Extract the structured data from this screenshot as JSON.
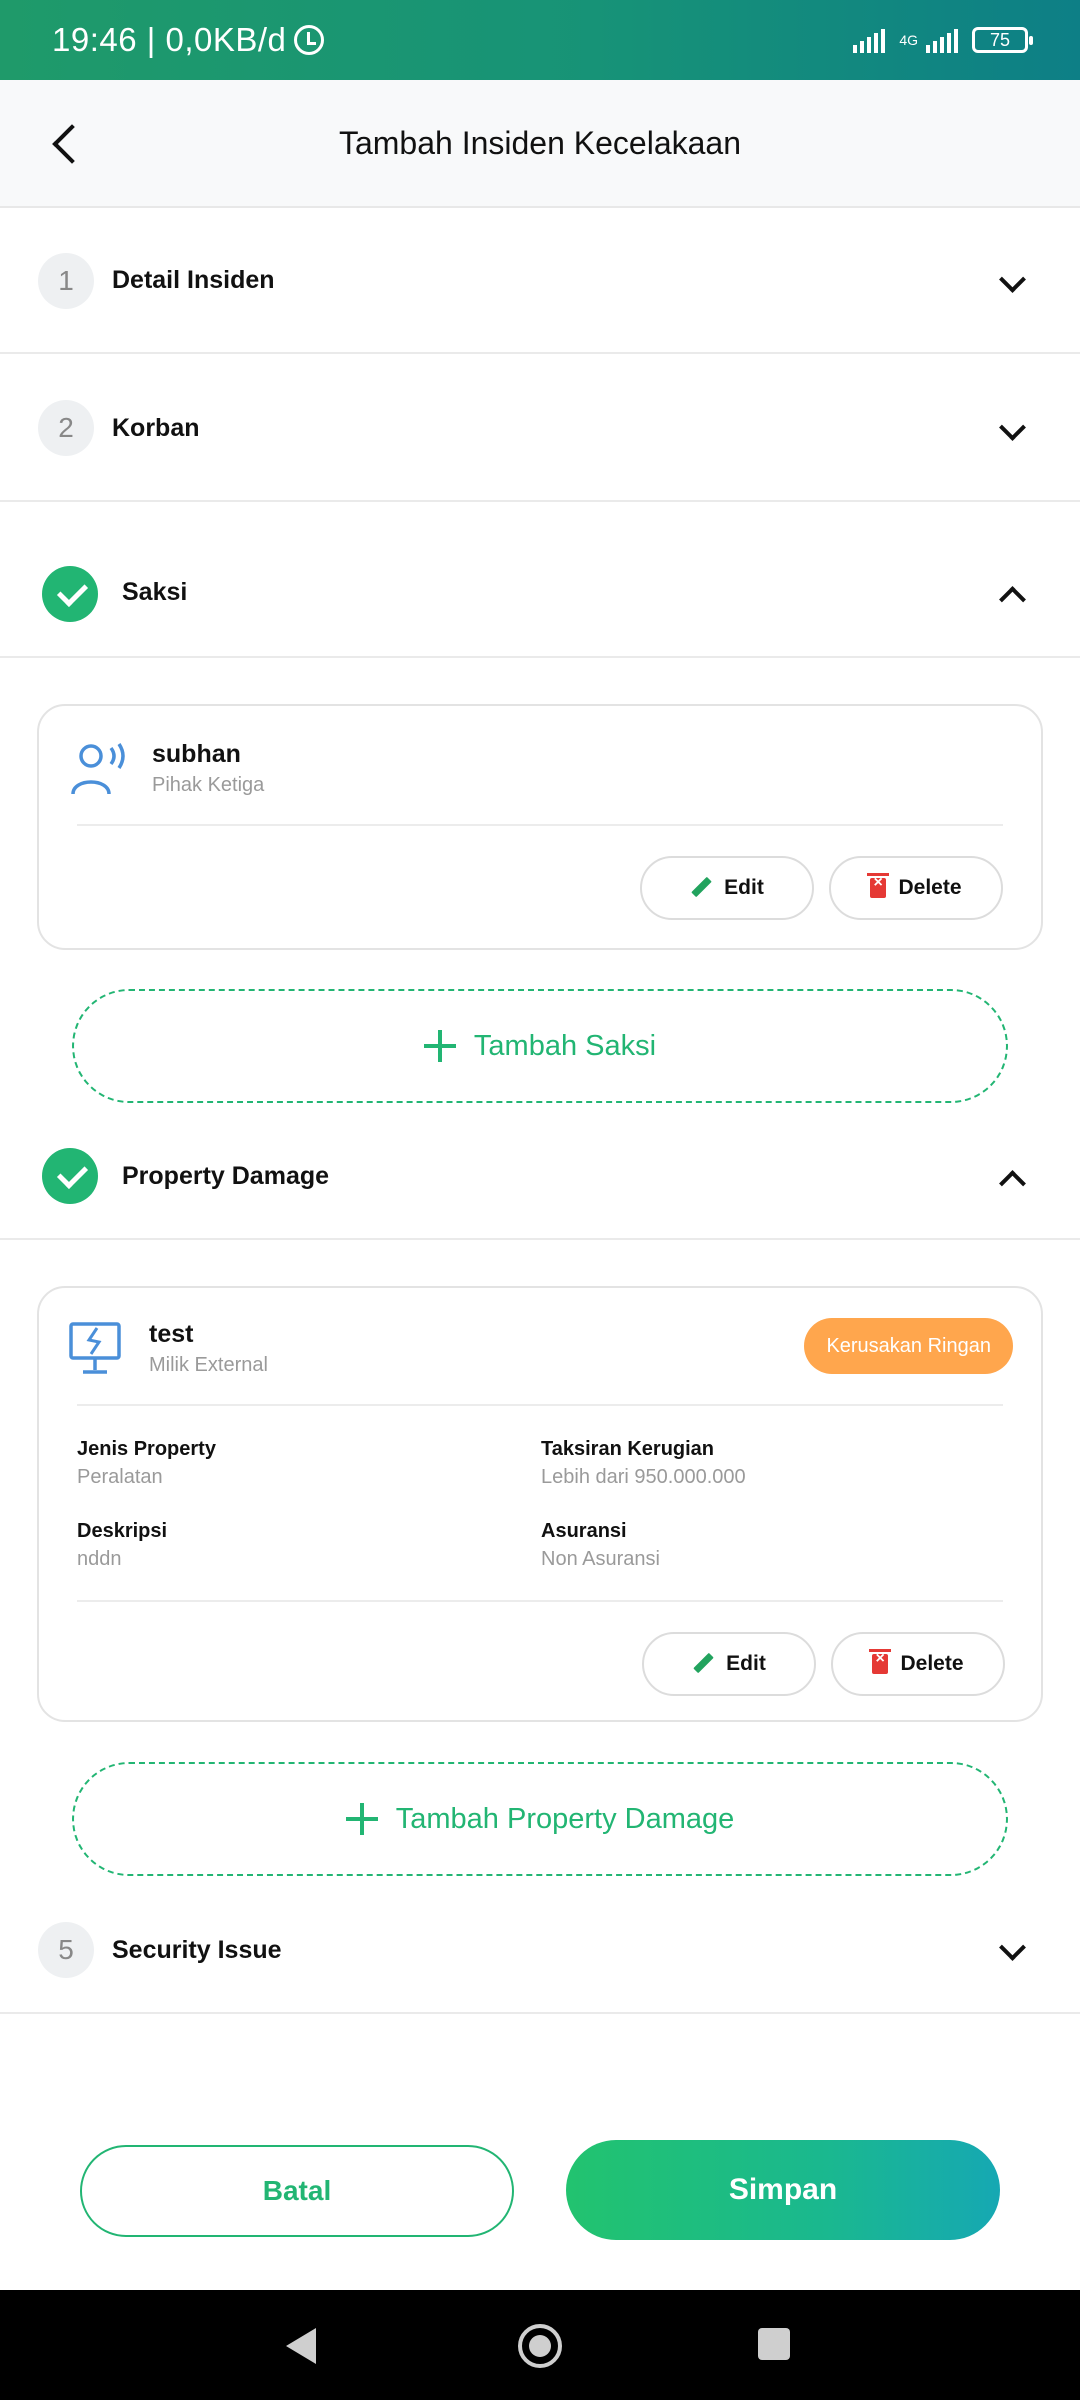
{
  "status_bar": {
    "time": "19:46 | 0,0KB/d",
    "network": "4G",
    "battery": "75"
  },
  "header": {
    "title": "Tambah Insiden Kecelakaan"
  },
  "sections": [
    {
      "number": "1",
      "title": "Detail Insiden"
    },
    {
      "number": "2",
      "title": "Korban"
    },
    {
      "title": "Saksi",
      "completed": true
    },
    {
      "title": "Property Damage",
      "completed": true
    },
    {
      "number": "5",
      "title": "Security Issue"
    }
  ],
  "saksi": {
    "name": "subhan",
    "role": "Pihak Ketiga",
    "edit_label": "Edit",
    "delete_label": "Delete",
    "add_label": "Tambah Saksi"
  },
  "property": {
    "name": "test",
    "owner": "Milik External",
    "badge": "Kerusakan Ringan",
    "jenis_label": "Jenis Property",
    "jenis_value": "Peralatan",
    "taksiran_label": "Taksiran Kerugian",
    "taksiran_value": "Lebih dari 950.000.000",
    "deskripsi_label": "Deskripsi",
    "deskripsi_value": "nddn",
    "asuransi_label": "Asuransi",
    "asuransi_value": "Non Asuransi",
    "edit_label": "Edit",
    "delete_label": "Delete",
    "add_label": "Tambah Property Damage"
  },
  "actions": {
    "cancel": "Batal",
    "save": "Simpan"
  },
  "colors": {
    "primary": "#22b573",
    "badge": "#ffa64d",
    "danger": "#e53935"
  }
}
